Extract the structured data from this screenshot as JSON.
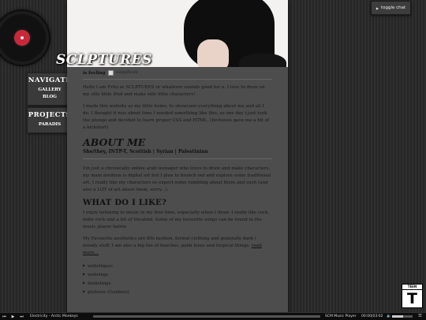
{
  "site": {
    "title": "SCLPTURES"
  },
  "nav": {
    "navigate": {
      "head": "NAVIGATE",
      "links": [
        "GALLERY",
        "BLOG"
      ]
    },
    "projects": {
      "head": "PROJECTS",
      "links": [
        "PARADIS"
      ]
    }
  },
  "status": {
    "label": "is feeling",
    "mood": "insignificant"
  },
  "intro": [
    "Hello I am Fritz or SCLPTURES or whatever sounds good for u. I love to draw on my silly little iPad and make silly little characters!",
    "I made this website as my little home, to showcase everything about me and all I do. I thought it was about time I needed something like this, so one day i just took the plunge and decided to learn proper CSS and HTML. (Invhouse gave me a bit of a kickstart)"
  ],
  "about": {
    "heading": "ABOUT ME",
    "identity": "She/they, INTP-T, Scottish | Syrian | Palestinian",
    "text": "I'm just a chronically online arab teenager who loves to draw and make characters, my main medium is digital art but I plan to branch out and explore some traditional art. I really like my characters so expect some rambling about them and such (and also a LOT of art about them, sorry...)."
  },
  "likes": {
    "heading": "WHAT DO I LIKE?",
    "music": "I enjoy listening to music in my free time, especially when I draw. I really like rock, indie rock and a bit of Vocaloid. Some of my favourite songs can be found in the music player below.",
    "aesthetics": "My Favourite aesthetics are 80s fashion, formal clothing and generally dark / moody stuff. I am also a big fan of beaches, palm trees and tropical things.",
    "read_more": "read more...",
    "list": [
      "webcliques",
      "webrings",
      "fanlistings",
      "pictures (Gunbies)"
    ]
  },
  "chat": {
    "label": "toggle chat",
    "icon": "triangle-right-icon"
  },
  "rating": {
    "label": "TEEN",
    "letter": "T"
  },
  "player": {
    "track": "Electricity - Arctic Monkeys",
    "name": "SCM Music Player",
    "time": "00:00|03:02",
    "progress": 0.0,
    "volume": 0.55
  }
}
